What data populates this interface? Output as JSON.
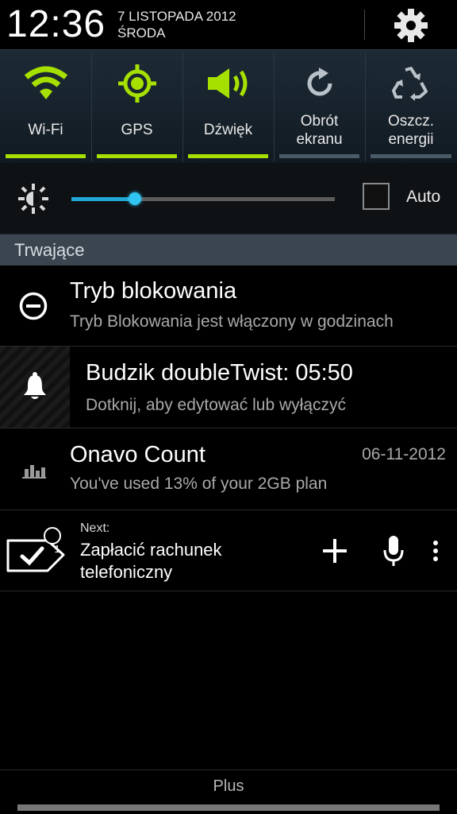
{
  "status": {
    "time": "12:36",
    "date_line1": "7 LISTOPADA 2012",
    "date_line2": "ŚRODA"
  },
  "quick_settings": [
    {
      "label_line1": "Wi-Fi",
      "label_line2": "",
      "state": "on",
      "icon": "wifi-icon"
    },
    {
      "label_line1": "GPS",
      "label_line2": "",
      "state": "on",
      "icon": "gps-icon"
    },
    {
      "label_line1": "Dźwięk",
      "label_line2": "",
      "state": "on",
      "icon": "speaker-icon"
    },
    {
      "label_line1": "Obrót",
      "label_line2": "ekranu",
      "state": "off",
      "icon": "rotate-icon"
    },
    {
      "label_line1": "Oszcz.",
      "label_line2": "energii",
      "state": "off",
      "icon": "recycle-icon"
    }
  ],
  "brightness": {
    "level": 0.24,
    "auto_label": "Auto",
    "auto_checked": false
  },
  "section_title": "Trwające",
  "notifications": [
    {
      "title": "Tryb blokowania",
      "text": "Tryb Blokowania jest włączony w godzinach",
      "icon": "block-mode-icon"
    },
    {
      "title": "Budzik doubleTwist: 05:50",
      "text": "Dotknij, aby edytować lub wyłączyć",
      "icon": "bell-icon"
    },
    {
      "title": "Onavo Count",
      "text": "You've used 13% of your 2GB plan",
      "time": "06-11-2012",
      "icon": "bar-chart-icon"
    }
  ],
  "todo": {
    "badge": "1",
    "next_label": "Next:",
    "task": "Zapłacić rachunek telefoniczny",
    "icon": "checkbox-task-icon"
  },
  "carrier": "Plus",
  "colors": {
    "accent_on": "#a6e000",
    "slider": "#22a6d4",
    "section_bg": "#3a4550"
  }
}
